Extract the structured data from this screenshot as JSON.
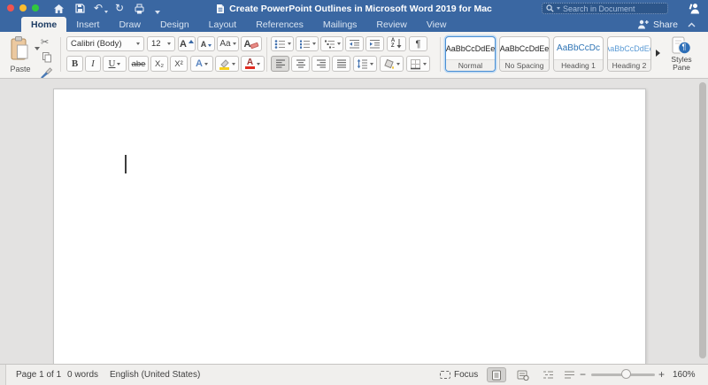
{
  "colors": {
    "titlebar_blue": "#3a67a2",
    "ribbon_bg": "#f4f3f1",
    "accent_blue": "#2b579a",
    "heading1_blue": "#2e74b5",
    "heading2_blue": "#5b9bd5",
    "selected_style_border": "#4a8fd3",
    "font_color_red": "#e02b20",
    "highlight_yellow": "#f6cf1b",
    "document_bg": "#e3e2e1"
  },
  "titlebar": {
    "title": "Create PowerPoint Outlines in Microsoft Word 2019 for Mac",
    "search_placeholder": "Search in Document",
    "glyphs": {
      "undo": "↶",
      "redo": "↻"
    }
  },
  "tabs": {
    "items": [
      {
        "label": "Home",
        "active": true
      },
      {
        "label": "Insert",
        "active": false
      },
      {
        "label": "Draw",
        "active": false
      },
      {
        "label": "Design",
        "active": false
      },
      {
        "label": "Layout",
        "active": false
      },
      {
        "label": "References",
        "active": false
      },
      {
        "label": "Mailings",
        "active": false
      },
      {
        "label": "Review",
        "active": false
      },
      {
        "label": "View",
        "active": false
      }
    ],
    "share_label": "Share"
  },
  "ribbon": {
    "paste_label": "Paste",
    "font_name": "Calibri (Body)",
    "font_size": "12",
    "glyphs": {
      "scissors": "✂",
      "bold": "B",
      "italic": "I",
      "underline": "U",
      "strikethrough": "abe",
      "subscript": "X₂",
      "superscript": "X²",
      "grow_font": "A",
      "shrink_font": "A",
      "change_case": "Aa",
      "clear_formatting": "A",
      "text_effects": "A",
      "font_color": "A",
      "pilcrow": "¶",
      "sort_a": "A",
      "sort_z": "Z"
    },
    "styles": {
      "cards": [
        {
          "sample": "AaBbCcDdEe",
          "label": "Normal",
          "selected": true
        },
        {
          "sample": "AaBbCcDdEe",
          "label": "No Spacing",
          "selected": false
        },
        {
          "sample": "AaBbCcDc",
          "label": "Heading 1",
          "selected": false
        },
        {
          "sample": "AaBbCcDdEe",
          "label": "Heading 2",
          "selected": false
        }
      ],
      "pane_line1": "Styles",
      "pane_line2": "Pane"
    }
  },
  "statusbar": {
    "page_indicator": "Page 1 of 1",
    "word_count": "0 words",
    "language": "English (United States)",
    "focus_label": "Focus",
    "zoom_out": "−",
    "zoom_in": "+",
    "zoom_level": "160%"
  }
}
